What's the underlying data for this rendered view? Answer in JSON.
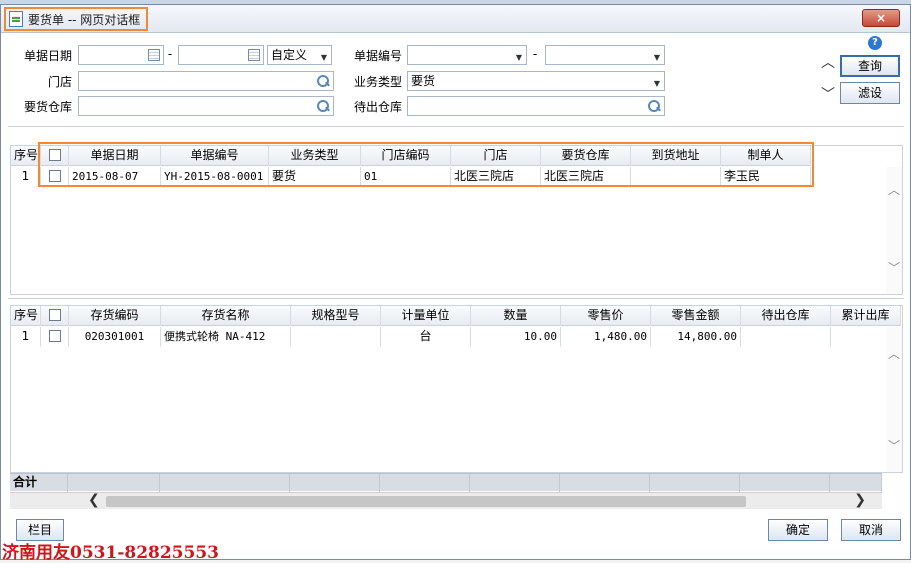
{
  "window": {
    "title": "要货单 -- 网页对话框",
    "close_label": "×"
  },
  "filters": {
    "date_label": "单据日期",
    "date_sep": "-",
    "date_range_option": "自定义",
    "docno_label": "单据编号",
    "docno_sep": "-",
    "store_label": "门店",
    "biz_type_label": "业务类型",
    "biz_type_value": "要货",
    "req_wh_label": "要货仓库",
    "out_wh_label": "待出仓库"
  },
  "buttons": {
    "help": "?",
    "query": "查询",
    "filter": "滤设",
    "columns": "栏目",
    "ok": "确定",
    "cancel": "取消"
  },
  "header_grid": {
    "columns": [
      "序号",
      "",
      "单据日期",
      "单据编号",
      "业务类型",
      "门店编码",
      "门店",
      "要货仓库",
      "到货地址",
      "制单人"
    ],
    "rows": [
      {
        "seq": "1",
        "date": "2015-08-07",
        "docno": "YH-2015-08-0001",
        "biz_type": "要货",
        "store_code": "01",
        "store": "北医三院店",
        "req_wh": "北医三院店",
        "address": "",
        "maker": "李玉民"
      }
    ]
  },
  "detail_grid": {
    "columns": [
      "序号",
      "",
      "存货编码",
      "存货名称",
      "规格型号",
      "计量单位",
      "数量",
      "零售价",
      "零售金额",
      "待出仓库",
      "累计出库"
    ],
    "rows": [
      {
        "seq": "1",
        "code": "020301001",
        "name": "便携式轮椅 NA-412",
        "spec": "",
        "unit": "台",
        "qty": "10.00",
        "price": "1,480.00",
        "amount": "14,800.00",
        "out_wh": "",
        "cum_out": ""
      }
    ],
    "total_label": "合计"
  },
  "watermark": "济南用友0531-82825553"
}
